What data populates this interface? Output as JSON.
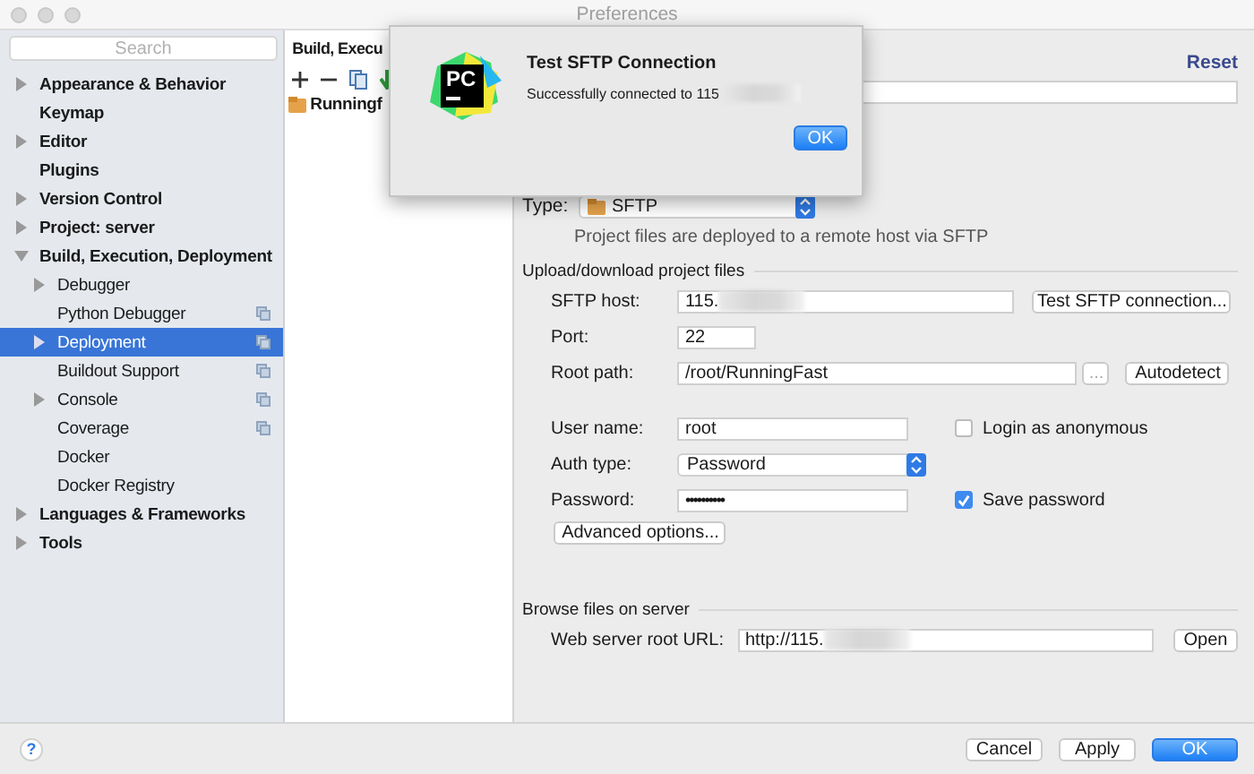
{
  "window": {
    "title": "Preferences"
  },
  "sidebar": {
    "search": {
      "placeholder": "Search"
    },
    "items": [
      {
        "label": "Appearance & Behavior",
        "expanded": false,
        "selected": false
      },
      {
        "label": "Keymap",
        "selected": false
      },
      {
        "label": "Editor",
        "expanded": false,
        "selected": false
      },
      {
        "label": "Plugins",
        "selected": false
      },
      {
        "label": "Version Control",
        "expanded": false,
        "selected": false
      },
      {
        "label": "Project: server",
        "expanded": false,
        "selected": false
      },
      {
        "label": "Build, Execution, Deployment",
        "expanded": true,
        "selected": false,
        "children": [
          {
            "label": "Debugger",
            "expanded": false,
            "selected": false
          },
          {
            "label": "Python Debugger",
            "selected": false,
            "project_scope": true
          },
          {
            "label": "Deployment",
            "expanded": false,
            "selected": true,
            "project_scope": true
          },
          {
            "label": "Buildout Support",
            "selected": false,
            "project_scope": true
          },
          {
            "label": "Console",
            "expanded": false,
            "selected": false,
            "project_scope": true
          },
          {
            "label": "Coverage",
            "selected": false,
            "project_scope": true
          },
          {
            "label": "Docker",
            "selected": false
          },
          {
            "label": "Docker Registry",
            "selected": false
          }
        ]
      },
      {
        "label": "Languages & Frameworks",
        "expanded": false,
        "selected": false
      },
      {
        "label": "Tools",
        "expanded": false,
        "selected": false
      }
    ]
  },
  "servers": {
    "breadcrumb": "Build, Execu",
    "items": [
      {
        "name": "Runningf"
      }
    ]
  },
  "panel": {
    "reset": "Reset",
    "type": {
      "label": "Type:",
      "value": "SFTP"
    },
    "note": "Project files are deployed to a remote host via SFTP",
    "upload_title": "Upload/download project files",
    "host": {
      "label": "SFTP host:",
      "value": "115.",
      "redacted": true,
      "button": "Test SFTP connection..."
    },
    "port": {
      "label": "Port:",
      "value": "22"
    },
    "root": {
      "label": "Root path:",
      "value": "/root/RunningFast",
      "browse": "...",
      "button": "Autodetect"
    },
    "user": {
      "label": "User name:",
      "value": "root",
      "check": {
        "label": "Login as anonymous",
        "checked": false
      }
    },
    "auth": {
      "label": "Auth type:",
      "value": "Password"
    },
    "password": {
      "label": "Password:",
      "value": "••••••••••",
      "check": {
        "label": "Save password",
        "checked": true
      }
    },
    "advanced": "Advanced options...",
    "browse_title": "Browse files on server",
    "url": {
      "label": "Web server root URL:",
      "value": "http://115.",
      "redacted": true,
      "button": "Open"
    }
  },
  "dialog": {
    "logo_text": "PC",
    "title": "Test SFTP Connection",
    "message": "Successfully connected to 115",
    "redacted": true,
    "button": "OK"
  },
  "footer": {
    "help": "?",
    "buttons": [
      {
        "label": "Cancel",
        "default": false
      },
      {
        "label": "Apply",
        "default": false
      },
      {
        "label": "OK",
        "default": true
      }
    ]
  }
}
